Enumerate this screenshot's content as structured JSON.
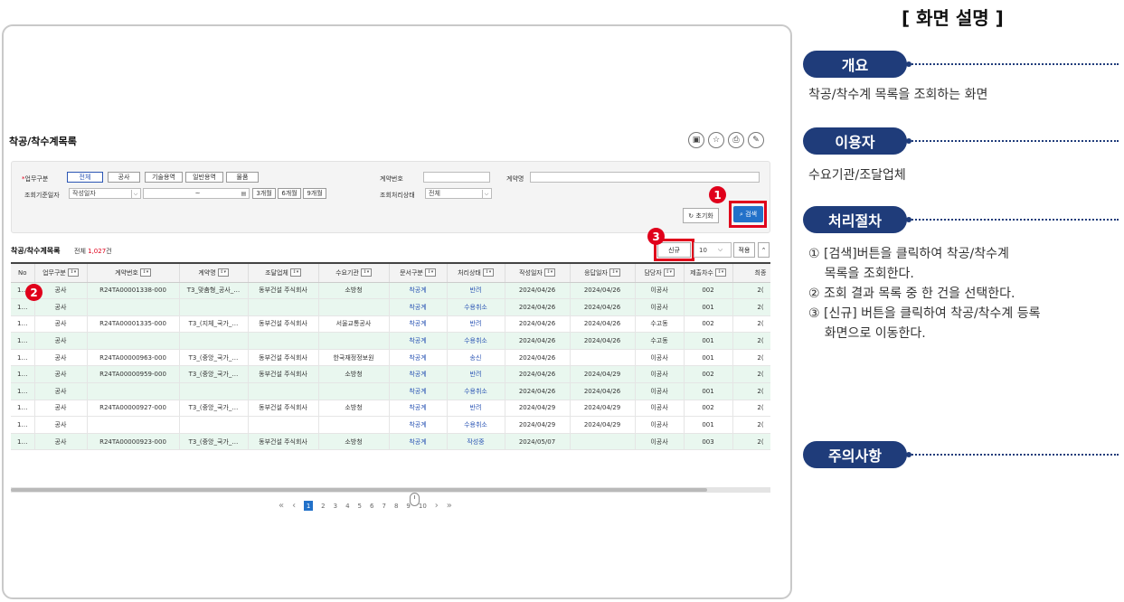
{
  "screen": {
    "page_title": "착공/착수계목록",
    "top_icons": [
      "save-icon",
      "star-icon",
      "print-icon",
      "settings-icon"
    ],
    "search": {
      "business_type_label": "업무구분",
      "business_type_options": [
        "전체",
        "공사",
        "기술용역",
        "일반용역",
        "물품"
      ],
      "business_type_selected": "전체",
      "date_label": "조회기준일자",
      "date_type_value": "작성일자",
      "date_range_sep": "~",
      "period_buttons": [
        "3개월",
        "6개월",
        "9개월"
      ],
      "contract_no_label": "계약번호",
      "contract_no_value": "",
      "contract_name_label": "계약명",
      "contract_name_value": "",
      "status_label": "조회처리상태",
      "status_value": "전체",
      "reset_label": "초기화",
      "search_label": "검색"
    },
    "list": {
      "title": "착공/착수계목록",
      "count_prefix": "전체 ",
      "count_value": "1,027",
      "count_suffix": "건",
      "new_label": "신규",
      "page_size": "10",
      "apply_label": "적용",
      "columns": [
        "No",
        "업무구분",
        "계약번호",
        "계약명",
        "조달업체",
        "수요기관",
        "문서구분",
        "처리상태",
        "작성일자",
        "응답일자",
        "담당자",
        "제출차수",
        "최종"
      ],
      "rows": [
        {
          "no": "1…",
          "biz": "공사",
          "contract_no": "R24TA00001338-000",
          "contract_name": "T3_맞춤형_공사_…",
          "vendor": "동부건설 주식회사",
          "agency": "소방청",
          "doc": "착공계",
          "status": "반려",
          "written": "2024/04/26",
          "response": "2024/04/26",
          "manager": "이공사",
          "seq": "002",
          "last": "2("
        },
        {
          "no": "1…",
          "biz": "공사",
          "contract_no": "",
          "contract_name": "",
          "vendor": "",
          "agency": "",
          "doc": "착공계",
          "status": "수용취소",
          "written": "2024/04/26",
          "response": "2024/04/26",
          "manager": "이공사",
          "seq": "001",
          "last": "2("
        },
        {
          "no": "1…",
          "biz": "공사",
          "contract_no": "R24TA00001335-000",
          "contract_name": "T3_(지체_국가_…",
          "vendor": "동부건설 주식회사",
          "agency": "서울교통공사",
          "doc": "착공계",
          "status": "반려",
          "written": "2024/04/26",
          "response": "2024/04/26",
          "manager": "수고동",
          "seq": "002",
          "last": "2("
        },
        {
          "no": "1…",
          "biz": "공사",
          "contract_no": "",
          "contract_name": "",
          "vendor": "",
          "agency": "",
          "doc": "착공계",
          "status": "수용취소",
          "written": "2024/04/26",
          "response": "2024/04/26",
          "manager": "수고동",
          "seq": "001",
          "last": "2("
        },
        {
          "no": "1…",
          "biz": "공사",
          "contract_no": "R24TA00000963-000",
          "contract_name": "T3_(중앙_국가_…",
          "vendor": "동부건설 주식회사",
          "agency": "한국재정정보원",
          "doc": "착공계",
          "status": "송신",
          "written": "2024/04/26",
          "response": "",
          "manager": "이공사",
          "seq": "001",
          "last": "2("
        },
        {
          "no": "1…",
          "biz": "공사",
          "contract_no": "R24TA00000959-000",
          "contract_name": "T3_(중앙_국가_…",
          "vendor": "동부건설 주식회사",
          "agency": "소방청",
          "doc": "착공계",
          "status": "반려",
          "written": "2024/04/26",
          "response": "2024/04/29",
          "manager": "이공사",
          "seq": "002",
          "last": "2("
        },
        {
          "no": "1…",
          "biz": "공사",
          "contract_no": "",
          "contract_name": "",
          "vendor": "",
          "agency": "",
          "doc": "착공계",
          "status": "수용취소",
          "written": "2024/04/26",
          "response": "2024/04/26",
          "manager": "이공사",
          "seq": "001",
          "last": "2("
        },
        {
          "no": "1…",
          "biz": "공사",
          "contract_no": "R24TA00000927-000",
          "contract_name": "T3_(중앙_국가_…",
          "vendor": "동부건설 주식회사",
          "agency": "소방청",
          "doc": "착공계",
          "status": "반려",
          "written": "2024/04/29",
          "response": "2024/04/29",
          "manager": "이공사",
          "seq": "002",
          "last": "2("
        },
        {
          "no": "1…",
          "biz": "공사",
          "contract_no": "",
          "contract_name": "",
          "vendor": "",
          "agency": "",
          "doc": "착공계",
          "status": "수용취소",
          "written": "2024/04/29",
          "response": "2024/04/29",
          "manager": "이공사",
          "seq": "001",
          "last": "2("
        },
        {
          "no": "1…",
          "biz": "공사",
          "contract_no": "R24TA00000923-000",
          "contract_name": "T3_(중앙_국가_…",
          "vendor": "동부건설 주식회사",
          "agency": "소방청",
          "doc": "착공계",
          "status": "작성중",
          "written": "2024/05/07",
          "response": "",
          "manager": "이공사",
          "seq": "003",
          "last": "2("
        }
      ],
      "pager": [
        "«",
        "‹",
        "1",
        "2",
        "3",
        "4",
        "5",
        "6",
        "7",
        "8",
        "9",
        "10",
        "›",
        "»"
      ],
      "current_page": "1"
    },
    "markers": [
      "1",
      "2",
      "3"
    ]
  },
  "description": {
    "title": "[ 화면 설명 ]",
    "overview_label": "개요",
    "overview_text": "착공/착수계 목록을 조회하는 화면",
    "users_label": "이용자",
    "users_text": "수요기관/조달업체",
    "procedure_label": "처리절차",
    "procedure_steps": [
      "① [검색]버튼을 클릭하여 착공/착수계",
      "    목록을 조회한다.",
      "② 조회 결과 목록 중 한 건을 선택한다.",
      "③ [신규] 버튼을 클릭하여 착공/착수계 등록",
      "    화면으로 이동한다."
    ],
    "caution_label": "주의사항"
  },
  "colors": {
    "accent_navy": "#1f3c7a",
    "highlight_red": "#e0001b",
    "primary_blue": "#2271c9",
    "row_green": "#e9f7ef"
  }
}
